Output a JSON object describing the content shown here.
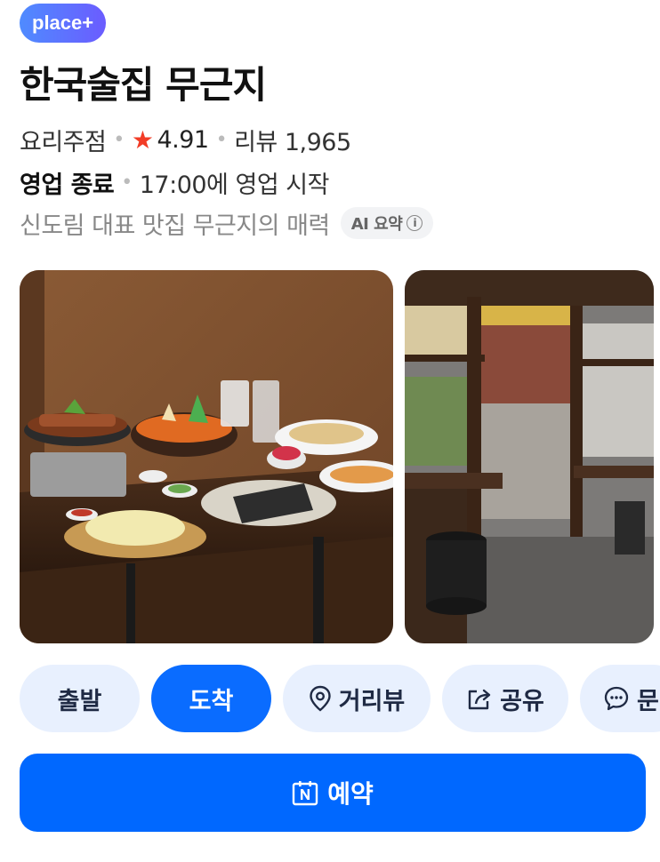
{
  "badge": "place+",
  "title": "한국술집 무근지",
  "info": {
    "category": "요리주점",
    "rating": "4.91",
    "reviews": "리뷰 1,965",
    "status": "영업 종료",
    "next_open": "17:00에 영업 시작",
    "summary": "신도림 대표 맛집 무근지의 매력",
    "ai_label": "AI 요약"
  },
  "actions": {
    "depart": "출발",
    "arrive": "도착",
    "street_view": "거리뷰",
    "share": "공유",
    "inquiry": "문"
  },
  "reserve_label": "예약",
  "colors": {
    "primary": "#0068ff",
    "chip_bg": "#e8f0fe",
    "star": "#f23c26"
  }
}
